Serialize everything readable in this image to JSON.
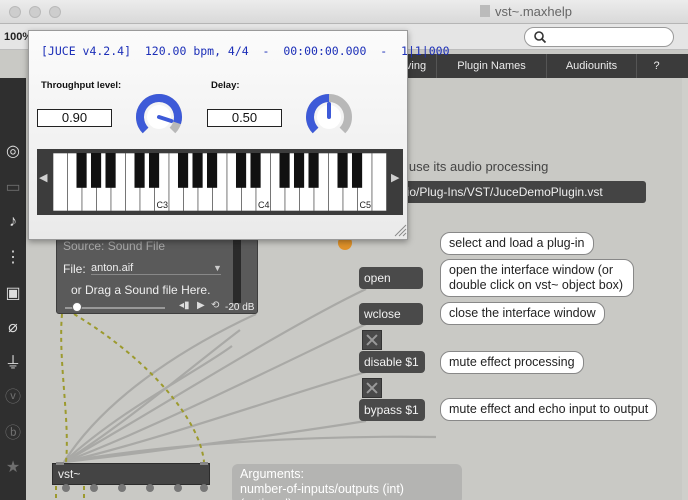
{
  "window": {
    "title": "vst~.maxhelp",
    "zoom": "100%"
  },
  "tabs": [
    {
      "label": "ving"
    },
    {
      "label": "Plugin Names"
    },
    {
      "label": "Audiounits"
    },
    {
      "label": "?"
    }
  ],
  "sidebar": {
    "icons": [
      "target-icon",
      "terminal-icon",
      "music-note-icon",
      "signal-flow-icon",
      "image-icon",
      "paperclip-icon",
      "plug-icon",
      "vimeo-icon",
      "bold-b-icon",
      "star-icon"
    ]
  },
  "juce": {
    "info": "[JUCE v4.2.4]  120.00 bpm, 4/4  -  00:00:00.000  -  1|1|000",
    "throughput_label": "Throughput level:",
    "throughput_value": "0.90",
    "throughput_level": 0.9,
    "delay_label": "Delay:",
    "delay_value": "0.50",
    "delay_level": 0.5,
    "octave_labels": [
      "C3",
      "C4",
      "C5"
    ],
    "accent_color": "#3d5ad8"
  },
  "patch": {
    "intro_text": "d use its audio processing",
    "plugin_path": "y/Audio/Plug-Ins/VST/JuceDemoPlugin.vst",
    "sound_file": {
      "source": "Source: Sound File",
      "file_label": "File:",
      "file_name": "anton.aif",
      "drop_hint": "or Drag a Sound file Here.",
      "level": "-20 dB"
    },
    "messages": [
      {
        "label": "open",
        "comment": "open the interface window (or double click on vst~ object box)"
      },
      {
        "label": "wclose",
        "comment": "close the interface window"
      },
      {
        "label": "disable $1",
        "comment": "mute effect processing"
      },
      {
        "label": "bypass $1",
        "comment": "mute effect and echo input to output"
      }
    ],
    "select_comment": "select and load a plug-in",
    "vst_object": "vst~",
    "arguments_title": "Arguments:",
    "arguments_line": "number-of-inputs/outputs (int) (optional)"
  }
}
